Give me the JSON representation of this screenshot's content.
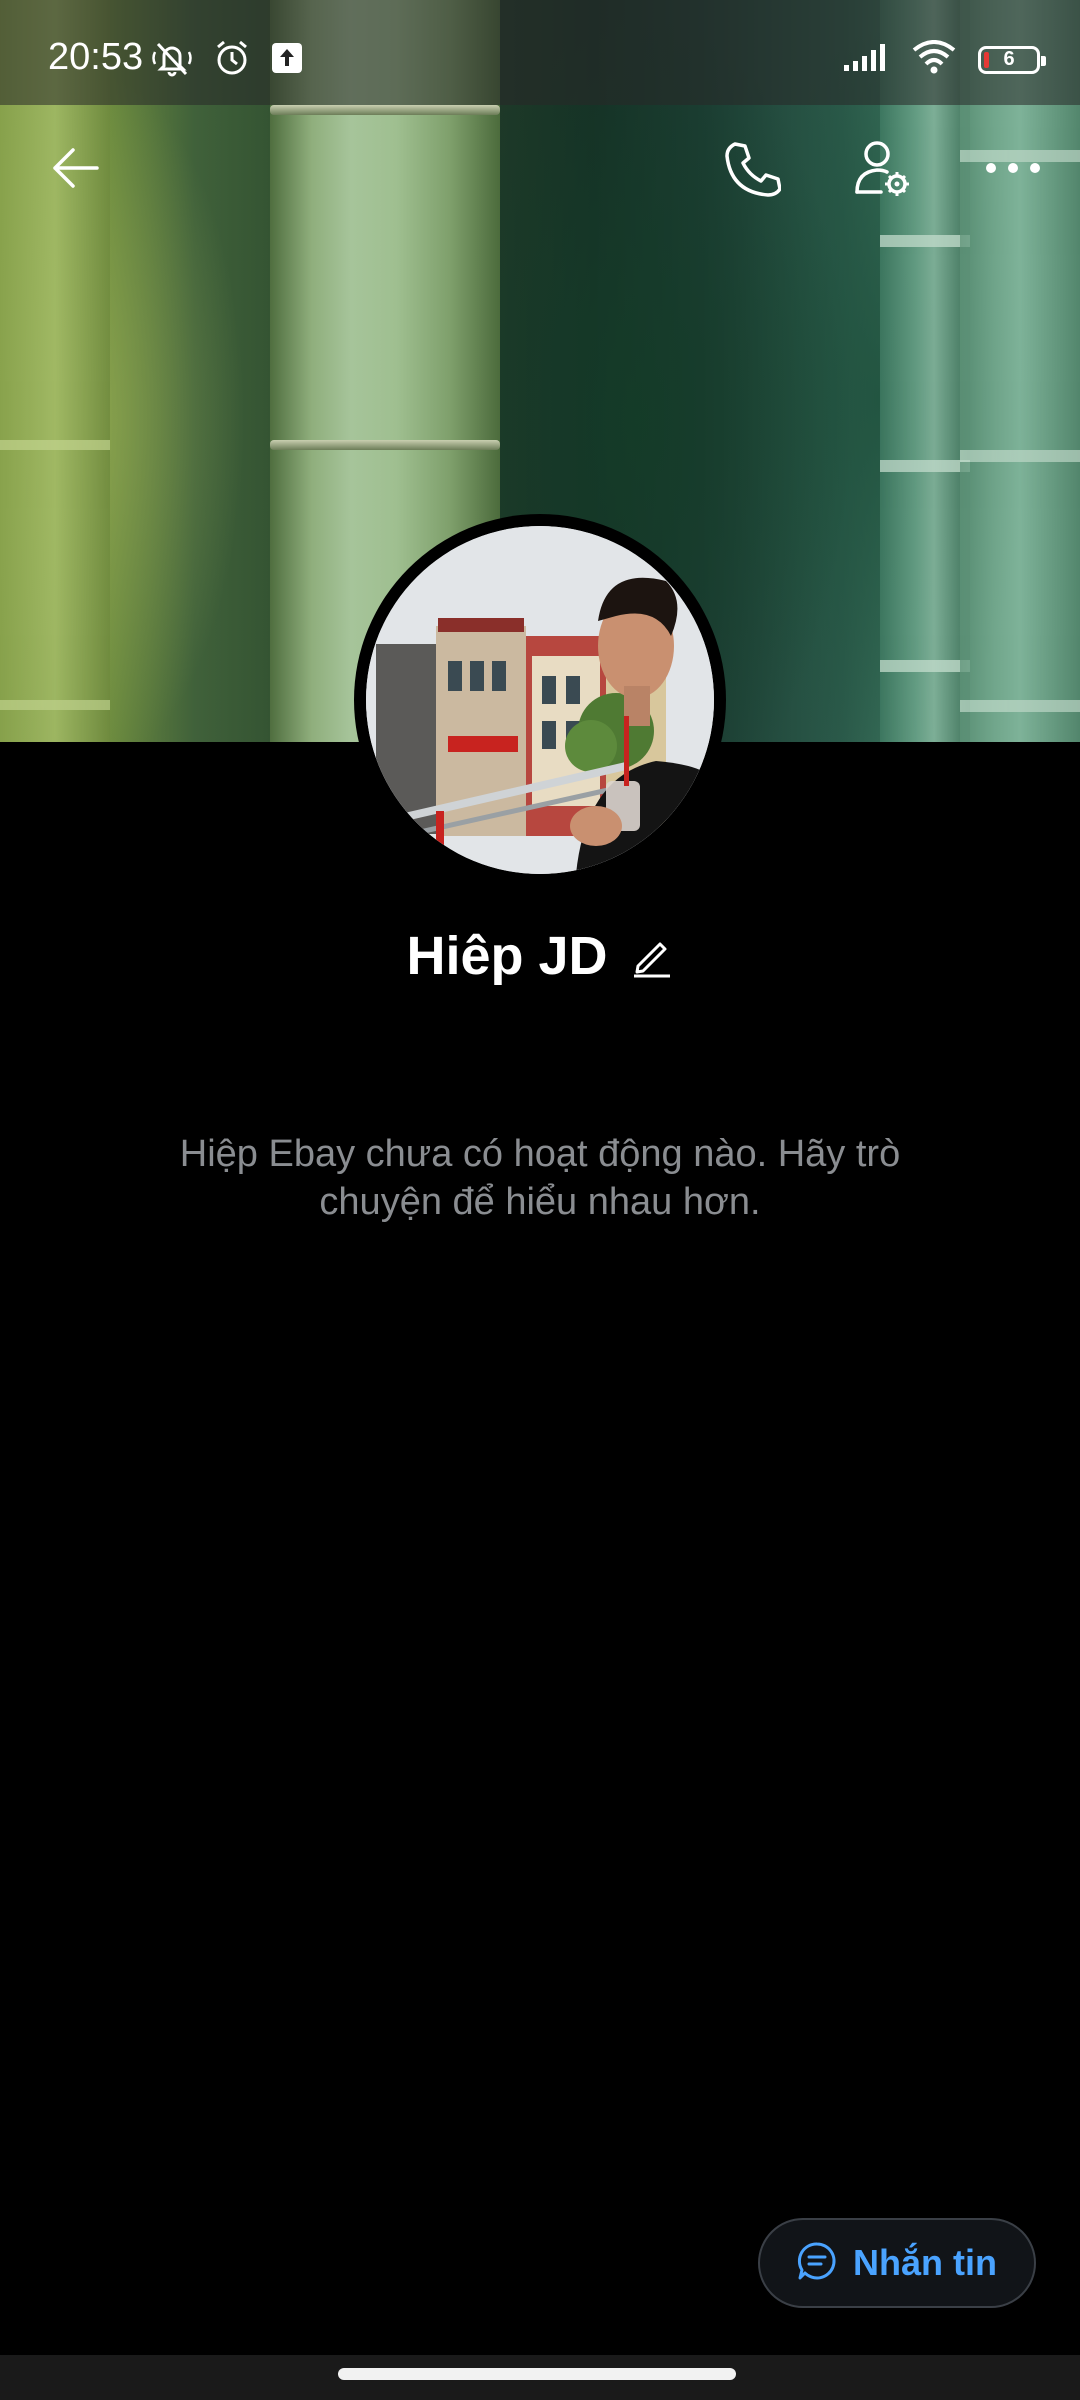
{
  "status_bar": {
    "time": "20:53",
    "battery_level": "6",
    "icons_left": [
      "mute-icon",
      "alarm-icon",
      "upload-icon"
    ],
    "icons_right": [
      "signal-icon",
      "wifi-icon",
      "battery-icon"
    ]
  },
  "toolbar": {
    "back_icon": "arrow-left-icon",
    "call_icon": "phone-icon",
    "settings_icon": "user-settings-icon",
    "more_icon": "more-horizontal-icon"
  },
  "profile": {
    "name": "Hiêp JD",
    "edit_icon": "pencil-icon",
    "empty_message": "Hiệp Ebay chưa có hoạt động nào. Hãy trò chuyện để hiểu nhau hơn."
  },
  "actions": {
    "message_label": "Nhắn tin",
    "message_icon": "chat-bubble-icon",
    "accent_color": "#4aa3ff"
  }
}
